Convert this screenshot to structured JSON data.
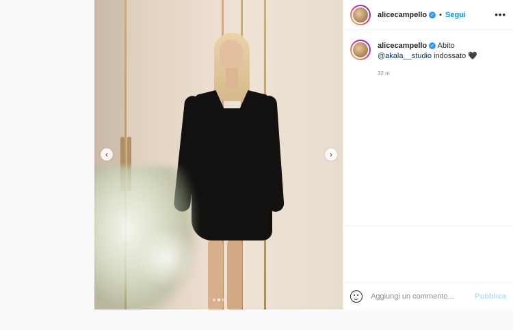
{
  "post": {
    "username": "alicecampello",
    "verified_icon": "verified-badge-icon",
    "separator": "•",
    "follow_label": "Segui",
    "more_label": "•••",
    "caption": {
      "username": "alicecampello",
      "text_before": "Abito ",
      "mention": "@akala__studio",
      "text_after": " indossato 🖤",
      "time": "32 m"
    },
    "carousel": {
      "prev_label": "‹",
      "next_label": "›",
      "slide_count": 3,
      "active_slide": 2
    },
    "add_comment": {
      "placeholder": "Aggiungi un commento...",
      "publish_label": "Pubblica"
    }
  },
  "colors": {
    "accent": "#0095f6",
    "publish_disabled": "#b2dffc",
    "verified": "#3897f0"
  }
}
